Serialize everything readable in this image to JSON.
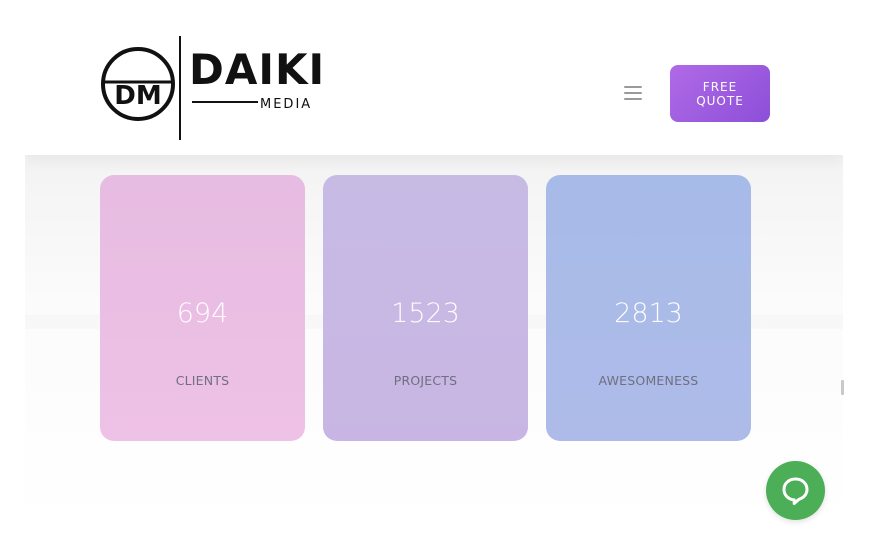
{
  "header": {
    "logo": {
      "monogram": "DM",
      "brand": "DAIKI",
      "tagline": "MEDIA"
    },
    "menu_icon": "hamburger-menu-icon",
    "quote_button": {
      "line1": "FREE",
      "line2": "QUOTE"
    }
  },
  "stats": [
    {
      "value": "694",
      "label": "CLIENTS"
    },
    {
      "value": "1523",
      "label": "PROJECTS"
    },
    {
      "value": "2813",
      "label": "AWESOMENESS"
    }
  ],
  "chat": {
    "icon": "chat-bubble-icon"
  },
  "colors": {
    "quote_button": "#9b5ee0",
    "card_clients": "#ebbfe4",
    "card_projects": "#c8b8e3",
    "card_awesomeness": "#aabbe8",
    "chat_button": "#4caf57"
  }
}
